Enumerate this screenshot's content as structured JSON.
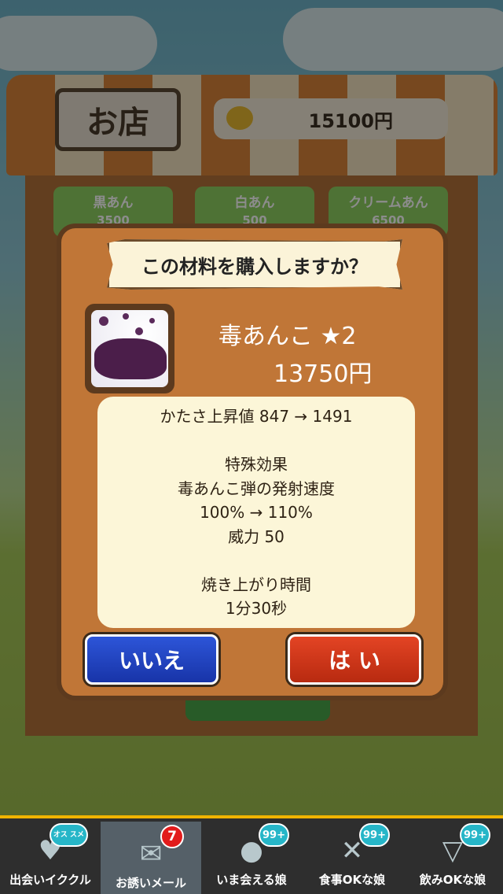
{
  "shop": {
    "title": "お店",
    "money": "15100円",
    "tabs": [
      {
        "name": "黒あん",
        "price": "3500"
      },
      {
        "name": "白あん",
        "price": "500"
      },
      {
        "name": "クリームあん",
        "price": "6500"
      }
    ]
  },
  "dialog": {
    "title": "この材料を購入しますか？",
    "item_name": "毒あんこ ★2",
    "item_price": "13750円",
    "info_lines": [
      "かたさ上昇値  847   →    1491",
      "",
      "特殊効果",
      "毒あんこ弾の発射速度",
      "100%  → 110%",
      "威力 50",
      "",
      "焼き上がり時間",
      "1分30秒"
    ],
    "no_label": "いいえ",
    "yes_label": "は い"
  },
  "nav": {
    "items": [
      {
        "label": "出会いイククル",
        "badge": "オス スメ",
        "icon": "heart-icon"
      },
      {
        "label": "お誘いメール",
        "badge": "7",
        "icon": "mail-icon"
      },
      {
        "label": "いま会える娘",
        "badge": "99+",
        "icon": "person-icon"
      },
      {
        "label": "食事OKな娘",
        "badge": "99+",
        "icon": "fork-knife-icon"
      },
      {
        "label": "飲みOKな娘",
        "badge": "99+",
        "icon": "cocktail-icon"
      }
    ]
  },
  "colors": {
    "dialog_bg": "#c07637",
    "no_button": "#2d55d8",
    "yes_button": "#e34424",
    "nav_accent": "#f0b400"
  }
}
